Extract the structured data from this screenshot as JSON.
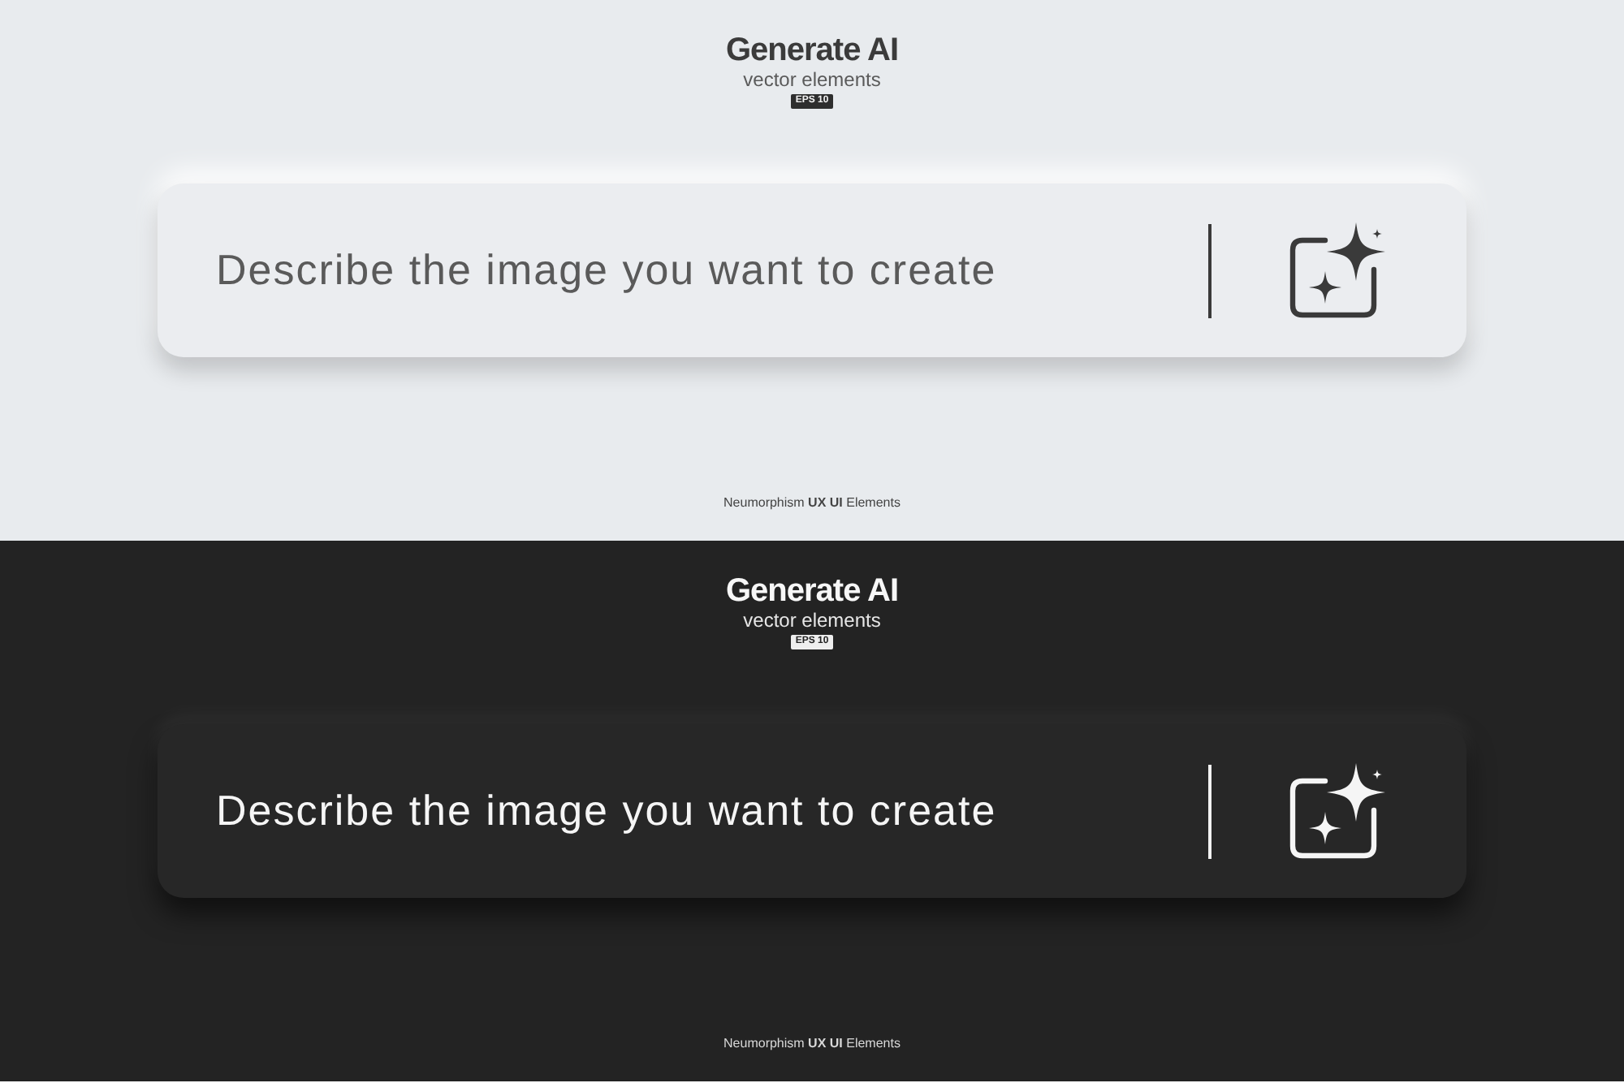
{
  "panels": [
    {
      "kind": "light",
      "title": "Generate AI",
      "subtitle": "vector elements",
      "tag": "EPS 10",
      "prompt_bar": {
        "placeholder": "Describe the image you want to create"
      },
      "caption": "Neumorphism **UX UI** Elements"
    },
    {
      "kind": "dark",
      "title": "Generate AI",
      "subtitle": "vector elements",
      "tag": "EPS 10",
      "prompt_bar": {
        "placeholder": "Describe the image you want to create"
      },
      "caption": "Neumorphism **UX UI** Elements"
    }
  ]
}
